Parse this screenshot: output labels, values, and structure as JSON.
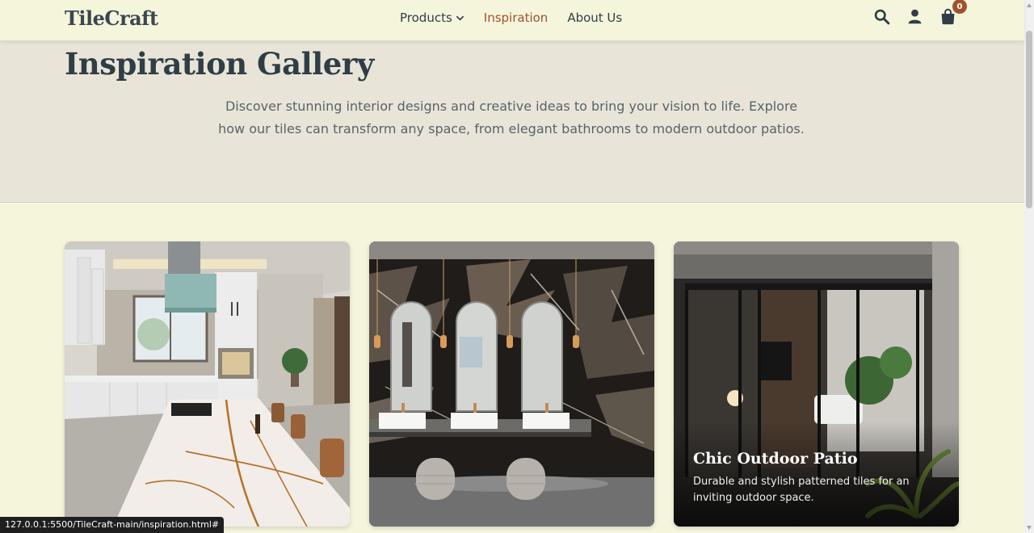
{
  "header": {
    "logo": "TileCraft",
    "nav": [
      {
        "label": "Products",
        "has_dropdown": true
      },
      {
        "label": "Inspiration",
        "active": true
      },
      {
        "label": "About Us"
      }
    ],
    "cart_count": "0",
    "icons": [
      "search-icon",
      "user-icon",
      "shopping-bag-icon"
    ]
  },
  "hero": {
    "title": "Inspiration Gallery",
    "description": "Discover stunning interior designs and creative ideas to bring your vision to life. Explore how our tiles can transform any space, from elegant bathrooms to modern outdoor patios."
  },
  "gallery": [
    {
      "image": "kitchen-photo"
    },
    {
      "image": "bathroom-photo"
    },
    {
      "image": "outdoor-patio-photo",
      "title": "Chic Outdoor Patio",
      "description": "Durable and stylish patterned tiles for an inviting outdoor space."
    }
  ],
  "status_bar": {
    "url": "127.0.0.1:5500/TileCraft-main/inspiration.html#"
  },
  "colors": {
    "accent": "#a0522d",
    "background": "#f5f5dc",
    "hero_bg": "#e8e5d8",
    "text": "#2f3e46"
  }
}
